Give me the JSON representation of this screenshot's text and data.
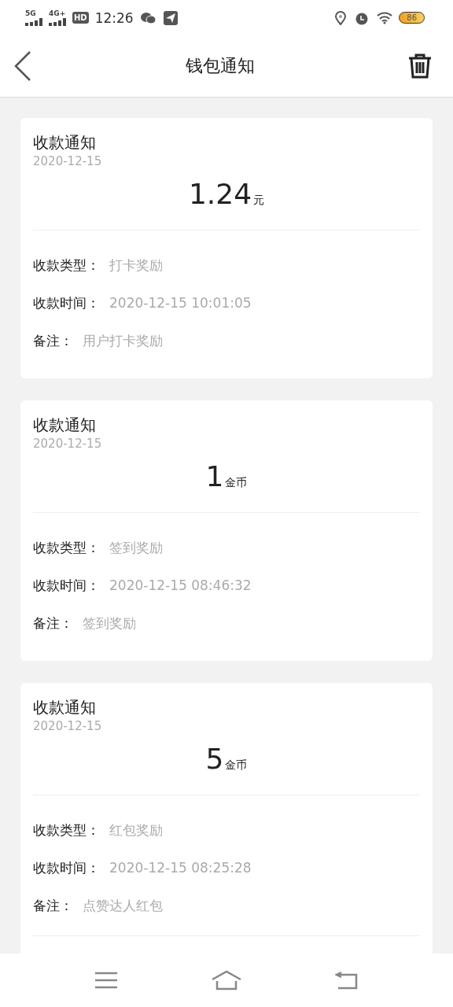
{
  "status_bar": {
    "network_1": "5G",
    "network_2": "4G+",
    "hd": "HD",
    "time": "12:26",
    "battery": "86"
  },
  "header": {
    "title": "钱包通知"
  },
  "cards": [
    {
      "title": "收款通知",
      "date": "2020-12-15",
      "amount": "1.24",
      "unit": "元",
      "rows": [
        {
          "label": "收款类型：",
          "value": "打卡奖励"
        },
        {
          "label": "收款时间：",
          "value": "2020-12-15 10:01:05"
        },
        {
          "label": "备注：",
          "value": "用户打卡奖励"
        }
      ],
      "more_below": false
    },
    {
      "title": "收款通知",
      "date": "2020-12-15",
      "amount": "1",
      "unit": "金币",
      "rows": [
        {
          "label": "收款类型：",
          "value": "签到奖励"
        },
        {
          "label": "收款时间：",
          "value": "2020-12-15 08:46:32"
        },
        {
          "label": "备注：",
          "value": "签到奖励"
        }
      ],
      "more_below": false
    },
    {
      "title": "收款通知",
      "date": "2020-12-15",
      "amount": "5",
      "unit": "金币",
      "rows": [
        {
          "label": "收款类型：",
          "value": "红包奖励"
        },
        {
          "label": "收款时间：",
          "value": "2020-12-15 08:25:28"
        },
        {
          "label": "备注：",
          "value": "点赞达人红包"
        }
      ],
      "more_below": true
    }
  ]
}
